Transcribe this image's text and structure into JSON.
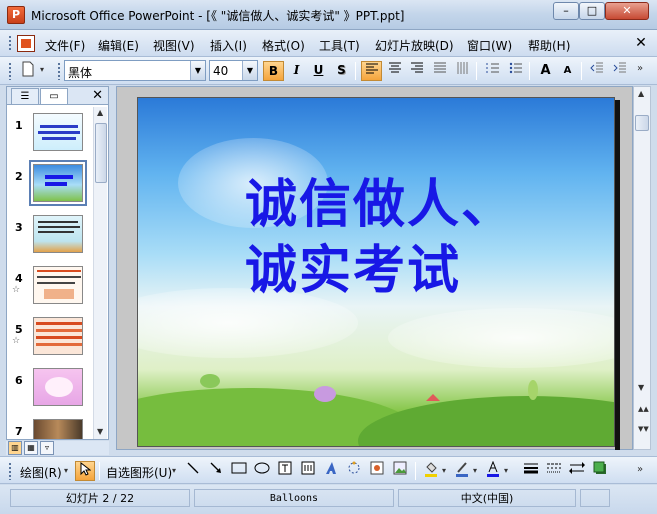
{
  "window": {
    "title": "Microsoft Office PowerPoint - [《 \"诚信做人、诚实考试\" 》PPT.ppt]",
    "min_label": "–",
    "max_label": "□",
    "close_label": "✕"
  },
  "menu": {
    "items": [
      "文件(F)",
      "编辑(E)",
      "视图(V)",
      "插入(I)",
      "格式(O)",
      "工具(T)",
      "幻灯片放映(D)",
      "窗口(W)",
      "帮助(H)"
    ],
    "close_label": "✕"
  },
  "format_toolbar": {
    "font_name": "黑体",
    "font_size": "40",
    "bold": "B",
    "italic": "I",
    "underline": "U",
    "shadow": "S",
    "grow_font": "A",
    "shrink_font": "A"
  },
  "thumbnail_pane": {
    "slides": [
      {
        "number": "1",
        "has_animation": false,
        "selected": false
      },
      {
        "number": "2",
        "has_animation": false,
        "selected": true
      },
      {
        "number": "3",
        "has_animation": false,
        "selected": false
      },
      {
        "number": "4",
        "has_animation": true,
        "selected": false
      },
      {
        "number": "5",
        "has_animation": true,
        "selected": false
      },
      {
        "number": "6",
        "has_animation": false,
        "selected": false
      },
      {
        "number": "7",
        "has_animation": false,
        "selected": false
      }
    ],
    "close_label": "✕",
    "star_glyph": "☆"
  },
  "slide": {
    "title_line1": "诚信做人、",
    "title_line2": "诚实考试"
  },
  "draw_toolbar": {
    "draw_label": "绘图(R)",
    "autoshapes_label": "自选图形(U)"
  },
  "status": {
    "slide_info": "幻灯片 2 / 22",
    "design": "Balloons",
    "language": "中文(中国)"
  },
  "colors": {
    "title_text": "#1818e6",
    "highlight": "#f5a43c",
    "chrome": "#cfdcec"
  }
}
